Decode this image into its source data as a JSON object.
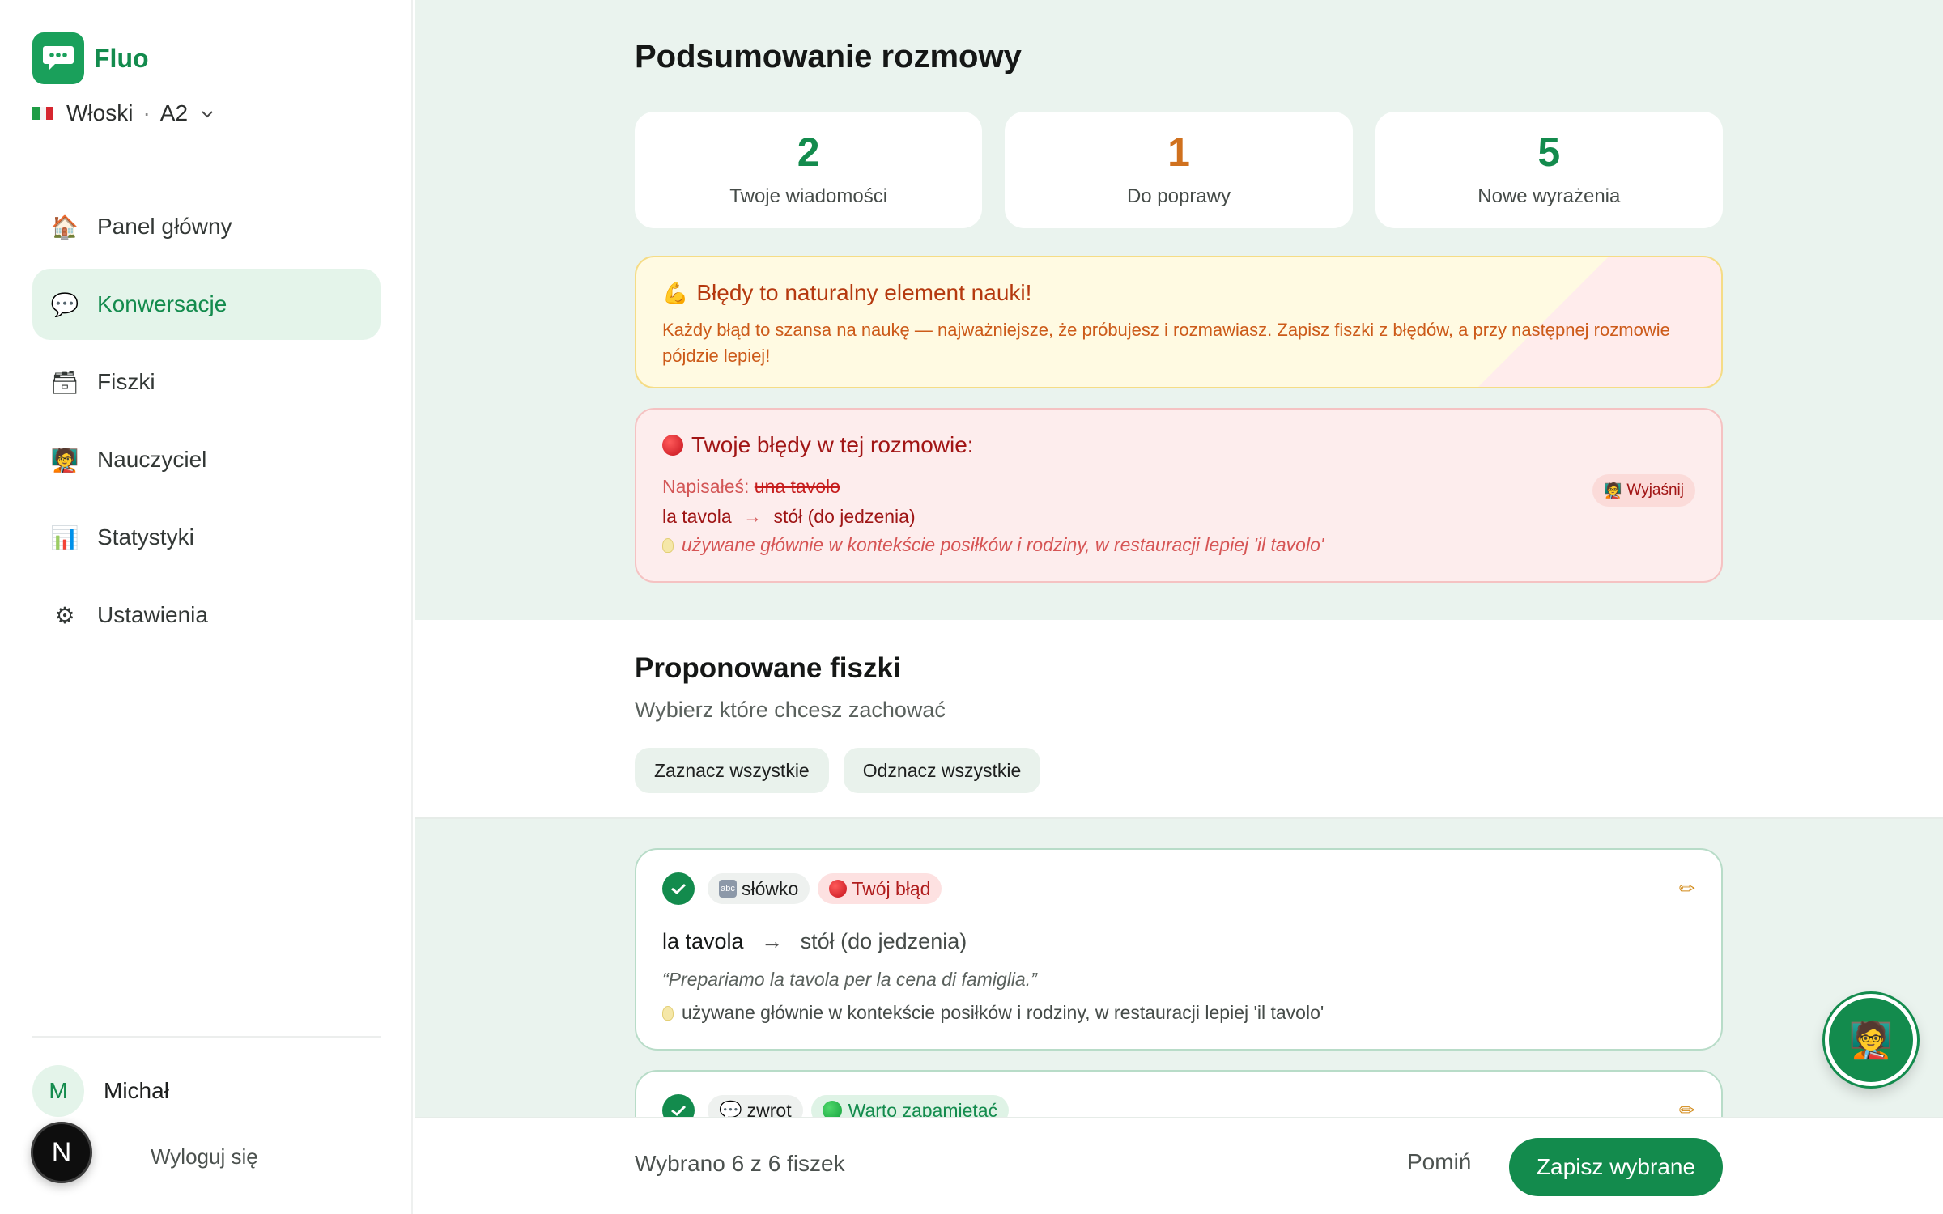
{
  "app": {
    "name": "Fluo",
    "language": "Włoski",
    "level": "A2"
  },
  "user": {
    "initial": "M",
    "name": "Michał",
    "logout_label": "Wyloguj się",
    "badge_letter": "N"
  },
  "nav": [
    {
      "label": "Panel główny",
      "icon": "house-icon",
      "glyph": "🏠",
      "active": false
    },
    {
      "label": "Konwersacje",
      "icon": "speech-bubble-icon",
      "glyph": "💬",
      "active": true
    },
    {
      "label": "Fiszki",
      "icon": "card-box-icon",
      "glyph": "🗃",
      "active": false
    },
    {
      "label": "Nauczyciel",
      "icon": "teacher-icon",
      "glyph": "🧑‍🏫",
      "active": false
    },
    {
      "label": "Statystyki",
      "icon": "bar-chart-icon",
      "glyph": "📊",
      "active": false
    },
    {
      "label": "Ustawienia",
      "icon": "gear-icon",
      "glyph": "⚙",
      "active": false
    }
  ],
  "summary": {
    "title": "Podsumowanie rozmowy",
    "stats": [
      {
        "value": "2",
        "label": "Twoje wiadomości",
        "color": "#138b4d"
      },
      {
        "value": "1",
        "label": "Do poprawy",
        "color": "#d0711e"
      },
      {
        "value": "5",
        "label": "Nowe wyrażenia",
        "color": "#138b4d"
      }
    ]
  },
  "motivation": {
    "title": "Błędy to naturalny element nauki!",
    "body": "Każdy błąd to szansa na naukę — najważniejsze, że próbujesz i rozmawiasz. Zapisz fiszki z błędów, a przy następnej rozmowie pójdzie lepiej!"
  },
  "errors": {
    "title": "Twoje błędy w tej rozmowie:",
    "wrote_label": "Napisałeś:",
    "wrote_value": "una tavolo",
    "correct": "la tavola",
    "arrow": "→",
    "translation": "stół (do jedzenia)",
    "note": "używane głównie w kontekście posiłków i rodziny, w restauracji lepiej 'il tavolo'",
    "explain_label": "Wyjaśnij"
  },
  "proposals": {
    "title": "Proponowane fiszki",
    "subtitle": "Wybierz które chcesz zachować",
    "select_all": "Zaznacz wszystkie",
    "deselect_all": "Odznacz wszystkie"
  },
  "cards": [
    {
      "type_label": "słówko",
      "source_label": "Twój błąd",
      "term": "la tavola",
      "translation": "stół (do jedzenia)",
      "example": "“Prepariamo la tavola per la cena di famiglia.”",
      "note": "używane głównie w kontekście posiłków i rodziny, w restauracji lepiej 'il tavolo'"
    },
    {
      "type_label": "zwrot",
      "source_label": "Warto zapamiętać"
    }
  ],
  "footer": {
    "selected_text": "Wybrano 6 z 6 fiszek",
    "skip_label": "Pomiń",
    "save_label": "Zapisz wybrane"
  },
  "colors": {
    "accent": "#138b4d",
    "warning": "#d0711e",
    "error": "#b01d1d"
  }
}
